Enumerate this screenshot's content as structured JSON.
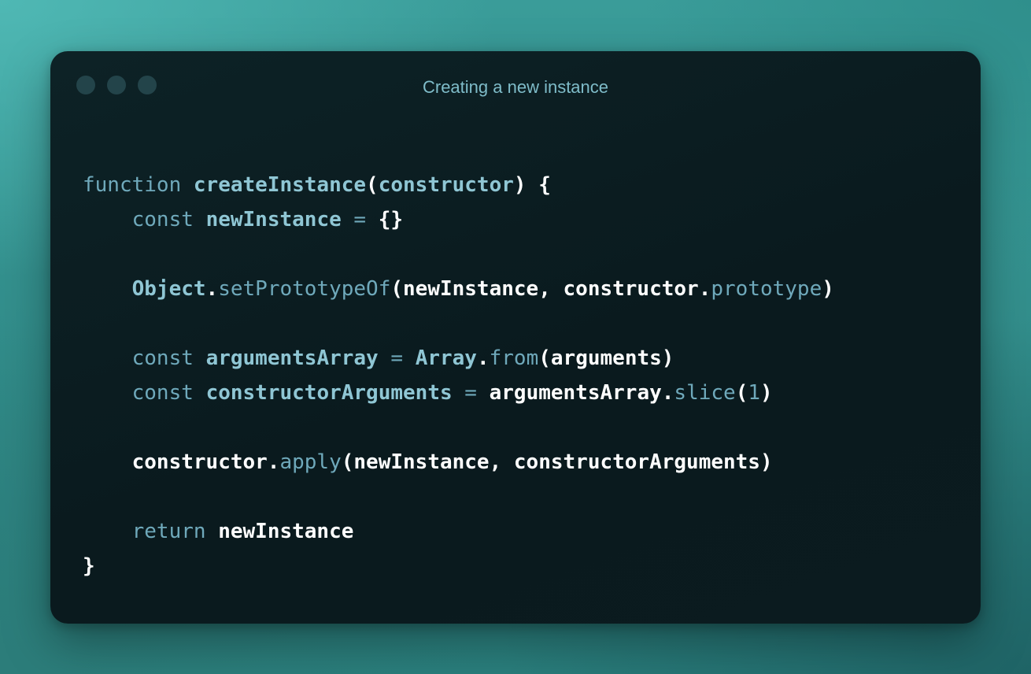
{
  "window": {
    "title": "Creating a new instance",
    "title_color": "#7fbcc9",
    "dot_color": "#23444a"
  },
  "code": {
    "line1": {
      "kw": "function",
      "name": "createInstance",
      "open": "(",
      "param": "constructor",
      "close": ") {"
    },
    "line2": {
      "kw": "const",
      "name": "newInstance",
      "op": "=",
      "value": "{}"
    },
    "line3": {
      "obj": "Object",
      "dot": ".",
      "method": "setPrototypeOf",
      "args_start": "(newInstance, constructor.",
      "prop": "prototype",
      "args_end": ")"
    },
    "line4": {
      "kw": "const",
      "name": "argumentsArray",
      "op": "=",
      "obj": "Array",
      "dot": ".",
      "method": "from",
      "args": "(arguments)"
    },
    "line5": {
      "kw": "const",
      "name": "constructorArguments",
      "op": "=",
      "target": "argumentsArray.",
      "method": "slice",
      "open": "(",
      "num": "1",
      "close": ")"
    },
    "line6": {
      "target": "constructor.",
      "method": "apply",
      "args": "(newInstance, constructorArguments)"
    },
    "line7": {
      "kw": "return",
      "value": "newInstance"
    },
    "line8": {
      "close": "}"
    }
  }
}
